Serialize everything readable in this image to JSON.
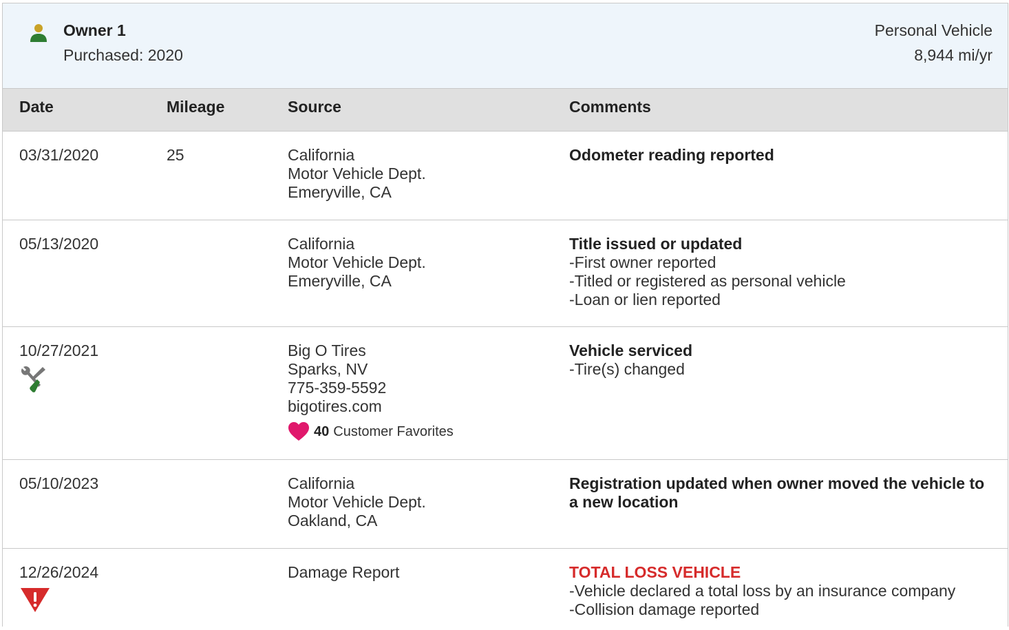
{
  "owner": {
    "name": "Owner 1",
    "purchased": "Purchased: 2020",
    "vehicle_type": "Personal Vehicle",
    "miles_per_year": "8,944 mi/yr",
    "icon": "person-icon"
  },
  "columns": {
    "date": "Date",
    "mileage": "Mileage",
    "source": "Source",
    "comments": "Comments"
  },
  "rows": [
    {
      "date": "03/31/2020",
      "mileage": "25",
      "source": [
        "California",
        "Motor Vehicle Dept.",
        "Emeryville, CA"
      ],
      "comment_title": "Odometer reading reported",
      "comment_items": []
    },
    {
      "date": "05/13/2020",
      "mileage": "",
      "source": [
        "California",
        "Motor Vehicle Dept.",
        "Emeryville, CA"
      ],
      "comment_title": "Title issued or updated",
      "comment_items": [
        "First owner reported",
        "Titled or registered as personal vehicle",
        "Loan or lien reported"
      ]
    },
    {
      "date": "10/27/2021",
      "mileage": "",
      "icon": "service-tools-icon",
      "source": [
        "Big O Tires",
        "Sparks, NV",
        "775-359-5592",
        "bigotires.com"
      ],
      "favorites_count": "40",
      "favorites_label": "Customer Favorites",
      "comment_title": "Vehicle serviced",
      "comment_items": [
        "Tire(s) changed"
      ]
    },
    {
      "date": "05/10/2023",
      "mileage": "",
      "source": [
        "California",
        "Motor Vehicle Dept.",
        "Oakland, CA"
      ],
      "comment_title": "Registration updated when owner moved the vehicle to a new location",
      "comment_items": []
    },
    {
      "date": "12/26/2024",
      "mileage": "",
      "icon": "warning-icon",
      "source": [
        "Damage Report"
      ],
      "comment_title": "TOTAL LOSS VEHICLE",
      "comment_items": [
        "Vehicle declared a total loss by an insurance company",
        "Collision damage reported"
      ]
    }
  ],
  "colors": {
    "header_bg": "#eef5fb",
    "table_header_bg": "#e0e0e0",
    "alert": "#d62b2b",
    "heart": "#e0186c",
    "icon_green": "#2e7d32",
    "icon_gray": "#777777"
  }
}
